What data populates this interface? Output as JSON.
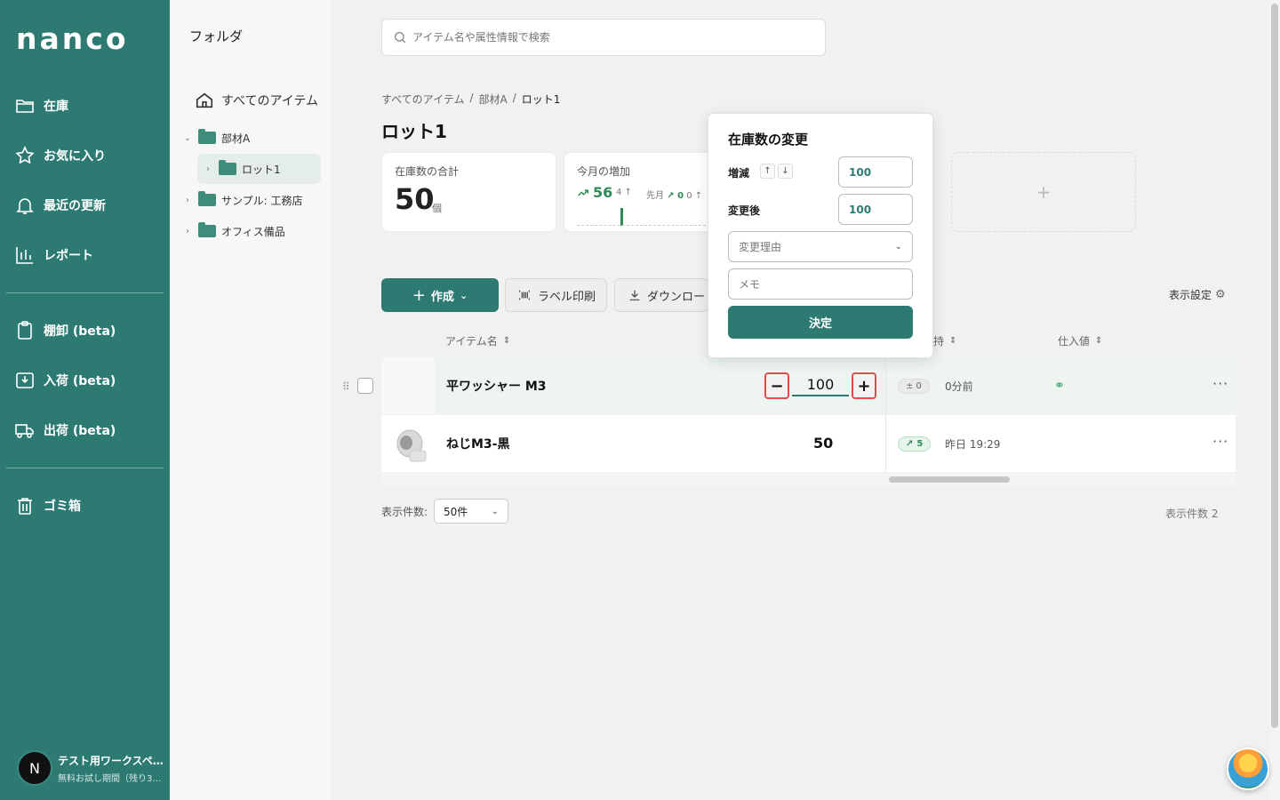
{
  "brand": {
    "logo": "nanco"
  },
  "nav": {
    "items": [
      {
        "label": "在庫",
        "icon": "folder-icon"
      },
      {
        "label": "お気に入り",
        "icon": "star-icon"
      },
      {
        "label": "最近の更新",
        "icon": "bell-icon"
      },
      {
        "label": "レポート",
        "icon": "chart-icon"
      },
      {
        "label": "棚卸 (beta)",
        "icon": "clipboard-icon"
      },
      {
        "label": "入荷 (beta)",
        "icon": "inbox-icon"
      },
      {
        "label": "出荷 (beta)",
        "icon": "truck-icon"
      },
      {
        "label": "ゴミ箱",
        "icon": "trash-icon"
      }
    ],
    "workspace": {
      "avatar": "N",
      "name": "テスト用ワークスペ…",
      "plan": "無料お試し期間（残り3…"
    }
  },
  "folders": {
    "title": "フォルダ",
    "all_items": "すべてのアイテム",
    "tree": [
      {
        "label": "部材A"
      },
      {
        "label": "ロット1"
      },
      {
        "label": "サンプル: 工務店"
      },
      {
        "label": "オフィス備品"
      }
    ]
  },
  "search": {
    "placeholder": "アイテム名や属性情報で検索"
  },
  "breadcrumb": {
    "items": [
      "すべてのアイテム",
      "部材A",
      "ロット1"
    ],
    "sep": "/"
  },
  "page": {
    "title": "ロット1"
  },
  "cards": {
    "total": {
      "label": "在庫数の合計",
      "value": "50",
      "unit": "個"
    },
    "increase": {
      "label": "今月の増加",
      "value": "56",
      "sub1": "4",
      "sub2": "先月",
      "sub3": "0",
      "sub4": "0"
    }
  },
  "toolbar": {
    "create": "作成",
    "label_print": "ラベル印刷",
    "download": "ダウンロー",
    "display_settings": "表示設定"
  },
  "table": {
    "headers": {
      "name": "アイテム名",
      "holder": "持",
      "cost": "仕入値"
    },
    "rows": [
      {
        "name": "平ワッシャー M3",
        "qty": "100",
        "delta": "± 0",
        "when": "0分前"
      },
      {
        "name": "ねじM3-黒",
        "qty": "50",
        "delta": "5",
        "when": "昨日 19:29"
      }
    ]
  },
  "pagination": {
    "label": "表示件数:",
    "value": "50件",
    "count": "表示件数 2"
  },
  "popover": {
    "title": "在庫数の変更",
    "delta_label": "増減",
    "delta_value": "100",
    "after_label": "変更後",
    "after_value": "100",
    "reason_placeholder": "変更理由",
    "memo_placeholder": "メモ",
    "submit": "決定"
  },
  "colors": {
    "brand": "#2d7a72",
    "positive": "#2e8b57",
    "highlight_border": "#e24c4c"
  }
}
